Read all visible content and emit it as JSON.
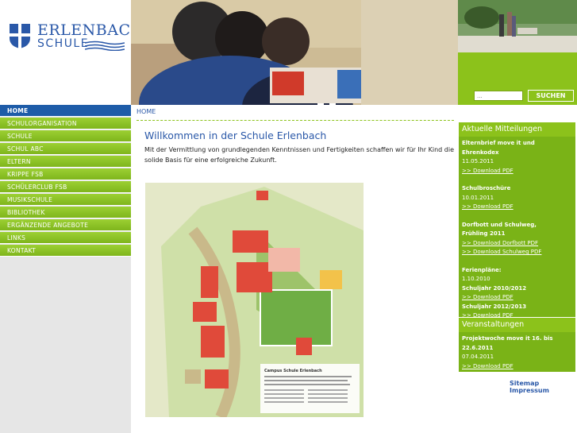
{
  "brand": {
    "name": "ERLENBACH",
    "sub": "SCHULE"
  },
  "search": {
    "placeholder": "...",
    "button": "SUCHEN"
  },
  "nav": {
    "items": [
      {
        "label": "HOME"
      },
      {
        "label": "SCHULORGANISATION"
      },
      {
        "label": "SCHULE"
      },
      {
        "label": "SCHUL ABC"
      },
      {
        "label": "ELTERN"
      },
      {
        "label": "KRIPPE FSB"
      },
      {
        "label": "SCHÜLERCLUB FSB"
      },
      {
        "label": "MUSIKSCHULE"
      },
      {
        "label": "BIBLIOTHEK"
      },
      {
        "label": "ERGÄNZENDE ANGEBOTE"
      },
      {
        "label": "LINKS"
      },
      {
        "label": "KONTAKT"
      }
    ]
  },
  "main": {
    "breadcrumb": "HOME",
    "title": "Willkommen in der Schule Erlenbach",
    "intro": "Mit der Vermittlung von grundlegenden Kenntnissen und Fertigkeiten schaffen wir für Ihr Kind die solide Basis für eine erfolgreiche Zukunft.",
    "map_caption": "Campus Schule Erlenbach"
  },
  "news": {
    "heading": "Aktuelle Mitteilungen",
    "entry1_title": "Elternbrief move it und Ehrenkodex",
    "entry1_date": "11.05.2011",
    "entry1_link": ">> Download PDF",
    "entry2_title": "Schulbroschüre",
    "entry2_date": "10.01.2011",
    "entry2_link": ">> Download PDF",
    "entry3_title": "Dorfbott und Schulweg,",
    "entry3_title2": "Frühling 2011",
    "entry3_link1": ">> Download Dorfbott PDF",
    "entry3_link2": ">> Download Schulweg PDF",
    "entry4_title": "Ferienpläne:",
    "entry4_date": "1.10.2010",
    "entry4_sub1": "Schuljahr 2010/2012",
    "entry4_link1": ">> Download PDF",
    "entry4_sub2": "Schuljahr 2012/2013",
    "entry4_link2": ">> Download PDF"
  },
  "events": {
    "heading": "Veranstaltungen",
    "entry_title": "Projektwoche move it 16. bis 22.6.2011",
    "entry_date": "07.04.2011",
    "entry_link": ">> Download PDF"
  },
  "footer": {
    "sitemap": "Sitemap",
    "impressum": "Impressum"
  },
  "colors": {
    "brand_blue": "#2a58a8",
    "green": "#8cc21b",
    "nav_active": "#1e5ca8"
  }
}
